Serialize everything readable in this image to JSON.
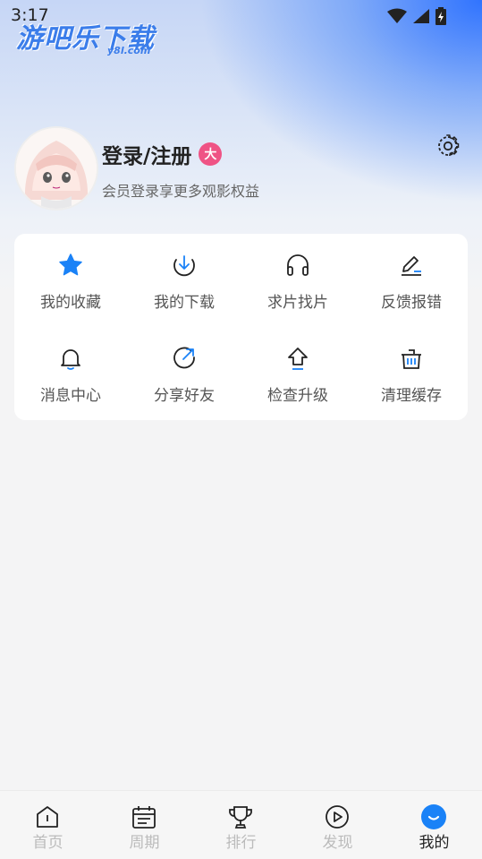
{
  "status_bar": {
    "time": "3:17"
  },
  "watermark": {
    "title": "游吧乐下载",
    "sub": "y8l.com"
  },
  "profile": {
    "login_label": "登录/注册",
    "vip_badge": "大",
    "subtitle": "会员登录享更多观影权益"
  },
  "menu": [
    {
      "label": "我的收藏",
      "icon": "star-icon"
    },
    {
      "label": "我的下载",
      "icon": "download-icon"
    },
    {
      "label": "求片找片",
      "icon": "headphones-icon"
    },
    {
      "label": "反馈报错",
      "icon": "edit-icon"
    },
    {
      "label": "消息中心",
      "icon": "bell-icon"
    },
    {
      "label": "分享好友",
      "icon": "share-icon"
    },
    {
      "label": "检查升级",
      "icon": "upgrade-icon"
    },
    {
      "label": "清理缓存",
      "icon": "trash-icon"
    }
  ],
  "tabs": [
    {
      "label": "首页",
      "icon": "home-icon",
      "active": false
    },
    {
      "label": "周期",
      "icon": "calendar-icon",
      "active": false
    },
    {
      "label": "排行",
      "icon": "trophy-icon",
      "active": false
    },
    {
      "label": "发现",
      "icon": "play-icon",
      "active": false
    },
    {
      "label": "我的",
      "icon": "profile-icon",
      "active": true
    }
  ],
  "colors": {
    "accent": "#1a82f7",
    "badge": "#ef5385",
    "star": "#1a82f7"
  }
}
